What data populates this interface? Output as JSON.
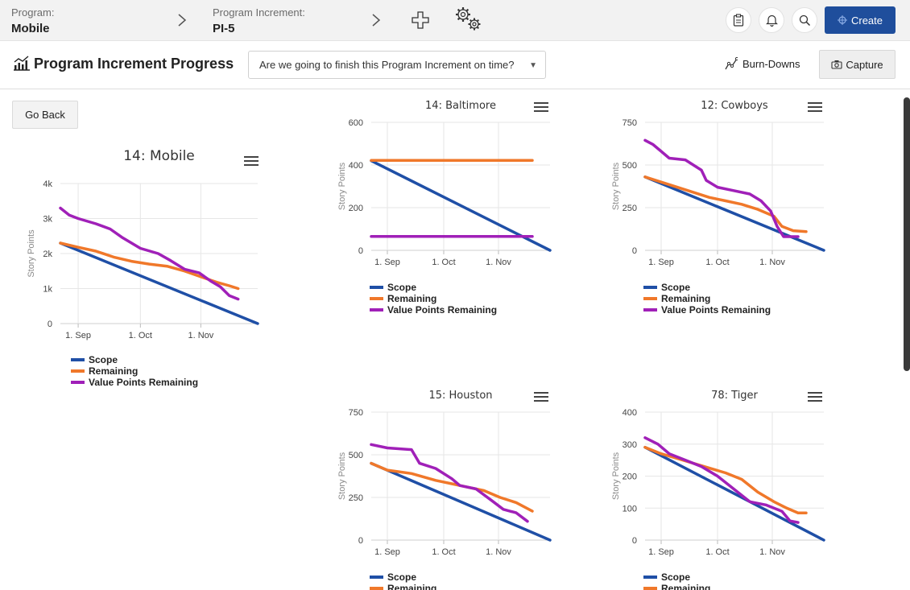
{
  "topbar": {
    "program_label": "Program:",
    "program_value": "Mobile",
    "increment_label": "Program Increment:",
    "increment_value": "PI-5",
    "create_label": "Create"
  },
  "header": {
    "title": "Program Increment Progress",
    "question_value": "Are we going to finish this Program Increment on time?",
    "burndowns_label": "Burn-Downs",
    "capture_label": "Capture"
  },
  "go_back_label": "Go Back",
  "colors": {
    "scope": "#1f4fa6",
    "remaining": "#f0782a",
    "value": "#a020b8",
    "accent": "#1f4e9c"
  },
  "legend": [
    "Scope",
    "Remaining",
    "Value Points Remaining"
  ],
  "chart_data": [
    {
      "type": "line",
      "title": "14: Mobile",
      "ylabel": "Story Points",
      "yticks": [
        "0",
        "1k",
        "2k",
        "3k",
        "4k"
      ],
      "ylim": [
        0,
        4000
      ],
      "xticks": [
        "1. Sep",
        "1. Oct",
        "1. Nov"
      ],
      "grid": true,
      "legend": "bottom",
      "series": [
        {
          "name": "Scope",
          "points": [
            [
              0,
              2300
            ],
            [
              111,
              0
            ]
          ]
        },
        {
          "name": "Remaining",
          "points": [
            [
              0,
              2300
            ],
            [
              10,
              2180
            ],
            [
              20,
              2070
            ],
            [
              30,
              1900
            ],
            [
              40,
              1780
            ],
            [
              50,
              1700
            ],
            [
              60,
              1640
            ],
            [
              70,
              1500
            ],
            [
              80,
              1320
            ],
            [
              88,
              1180
            ],
            [
              95,
              1080
            ],
            [
              100,
              1000
            ]
          ]
        },
        {
          "name": "Value Points Remaining",
          "points": [
            [
              0,
              3300
            ],
            [
              5,
              3100
            ],
            [
              10,
              3000
            ],
            [
              20,
              2850
            ],
            [
              28,
              2700
            ],
            [
              35,
              2450
            ],
            [
              45,
              2150
            ],
            [
              55,
              2000
            ],
            [
              62,
              1800
            ],
            [
              70,
              1550
            ],
            [
              78,
              1450
            ],
            [
              85,
              1200
            ],
            [
              90,
              1050
            ],
            [
              95,
              800
            ],
            [
              100,
              700
            ]
          ]
        }
      ]
    },
    {
      "type": "line",
      "title": "14: Baltimore",
      "ylabel": "Story Points",
      "yticks": [
        "0",
        "200",
        "400",
        "600"
      ],
      "ylim": [
        0,
        600
      ],
      "xticks": [
        "1. Sep",
        "1. Oct",
        "1. Nov"
      ],
      "grid": true,
      "legend": "bottom",
      "series": [
        {
          "name": "Scope",
          "points": [
            [
              0,
              420
            ],
            [
              111,
              0
            ]
          ]
        },
        {
          "name": "Remaining",
          "points": [
            [
              0,
              422
            ],
            [
              100,
              422
            ]
          ]
        },
        {
          "name": "Value Points Remaining",
          "points": [
            [
              0,
              65
            ],
            [
              100,
              65
            ]
          ]
        }
      ]
    },
    {
      "type": "line",
      "title": "12: Cowboys",
      "ylabel": "Story Points",
      "yticks": [
        "0",
        "250",
        "500",
        "750"
      ],
      "ylim": [
        0,
        750
      ],
      "xticks": [
        "1. Sep",
        "1. Oct",
        "1. Nov"
      ],
      "grid": true,
      "legend": "bottom",
      "series": [
        {
          "name": "Scope",
          "points": [
            [
              0,
              430
            ],
            [
              111,
              0
            ]
          ]
        },
        {
          "name": "Remaining",
          "points": [
            [
              0,
              430
            ],
            [
              10,
              400
            ],
            [
              20,
              370
            ],
            [
              30,
              340
            ],
            [
              40,
              310
            ],
            [
              50,
              290
            ],
            [
              60,
              270
            ],
            [
              70,
              240
            ],
            [
              80,
              200
            ],
            [
              85,
              140
            ],
            [
              92,
              115
            ],
            [
              100,
              110
            ]
          ]
        },
        {
          "name": "Value Points Remaining",
          "points": [
            [
              0,
              645
            ],
            [
              5,
              620
            ],
            [
              10,
              580
            ],
            [
              15,
              540
            ],
            [
              25,
              530
            ],
            [
              35,
              470
            ],
            [
              38,
              410
            ],
            [
              45,
              370
            ],
            [
              55,
              350
            ],
            [
              65,
              330
            ],
            [
              72,
              290
            ],
            [
              78,
              230
            ],
            [
              82,
              140
            ],
            [
              86,
              80
            ],
            [
              95,
              80
            ]
          ]
        }
      ]
    },
    {
      "type": "line",
      "title": "15: Houston",
      "ylabel": "Story Points",
      "yticks": [
        "0",
        "250",
        "500",
        "750"
      ],
      "ylim": [
        0,
        750
      ],
      "xticks": [
        "1. Sep",
        "1. Oct",
        "1. Nov"
      ],
      "grid": true,
      "legend": "bottom",
      "series": [
        {
          "name": "Scope",
          "points": [
            [
              0,
              450
            ],
            [
              111,
              0
            ]
          ]
        },
        {
          "name": "Remaining",
          "points": [
            [
              0,
              450
            ],
            [
              10,
              410
            ],
            [
              25,
              390
            ],
            [
              40,
              350
            ],
            [
              50,
              330
            ],
            [
              60,
              310
            ],
            [
              70,
              290
            ],
            [
              80,
              250
            ],
            [
              90,
              220
            ],
            [
              100,
              170
            ]
          ]
        },
        {
          "name": "Value Points Remaining",
          "points": [
            [
              0,
              560
            ],
            [
              10,
              540
            ],
            [
              25,
              530
            ],
            [
              30,
              450
            ],
            [
              40,
              420
            ],
            [
              50,
              360
            ],
            [
              55,
              320
            ],
            [
              65,
              300
            ],
            [
              75,
              230
            ],
            [
              82,
              180
            ],
            [
              90,
              160
            ],
            [
              97,
              110
            ]
          ]
        }
      ]
    },
    {
      "type": "line",
      "title": "78: Tiger",
      "ylabel": "Story Points",
      "yticks": [
        "0",
        "100",
        "200",
        "300",
        "400"
      ],
      "ylim": [
        0,
        400
      ],
      "xticks": [
        "1. Sep",
        "1. Oct",
        "1. Nov"
      ],
      "grid": true,
      "legend": "bottom",
      "series": [
        {
          "name": "Scope",
          "points": [
            [
              0,
              290
            ],
            [
              111,
              0
            ]
          ]
        },
        {
          "name": "Remaining",
          "points": [
            [
              0,
              290
            ],
            [
              10,
              270
            ],
            [
              20,
              255
            ],
            [
              30,
              240
            ],
            [
              40,
              225
            ],
            [
              50,
              210
            ],
            [
              60,
              190
            ],
            [
              70,
              150
            ],
            [
              80,
              120
            ],
            [
              88,
              100
            ],
            [
              95,
              85
            ],
            [
              100,
              85
            ]
          ]
        },
        {
          "name": "Value Points Remaining",
          "points": [
            [
              0,
              320
            ],
            [
              8,
              300
            ],
            [
              15,
              270
            ],
            [
              25,
              250
            ],
            [
              35,
              230
            ],
            [
              45,
              200
            ],
            [
              55,
              160
            ],
            [
              65,
              120
            ],
            [
              75,
              110
            ],
            [
              85,
              90
            ],
            [
              90,
              60
            ],
            [
              95,
              55
            ]
          ]
        }
      ]
    }
  ]
}
